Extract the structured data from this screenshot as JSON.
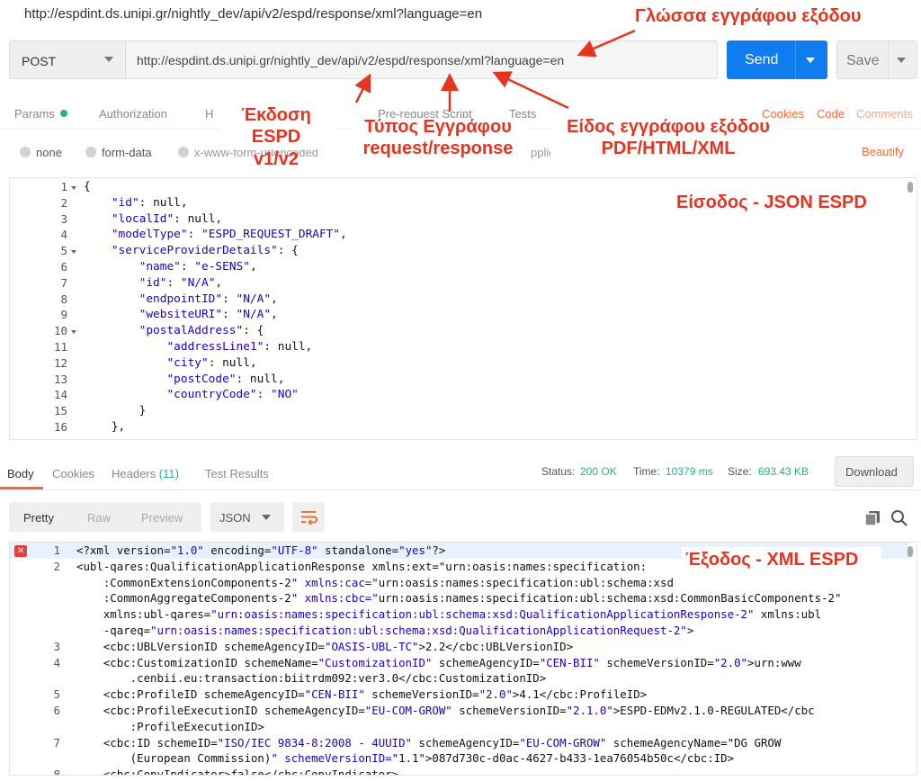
{
  "window": {
    "title_url": "http://espdint.ds.unipi.gr/nightly_dev/api/v2/espd/response/xml?language=en"
  },
  "request": {
    "method": "POST",
    "url": "http://espdint.ds.unipi.gr/nightly_dev/api/v2/espd/response/xml?language=en",
    "send_label": "Send",
    "save_label": "Save",
    "tabs": {
      "params": "Params",
      "authorization": "Authorization",
      "headers": "H",
      "prerequest": "Pre-request Script",
      "tests": "Tests",
      "cookies": "Cookies",
      "code": "Code",
      "comments": "Comments"
    },
    "body_types": {
      "none": "none",
      "form_data": "form-data",
      "x_www": "x-www-form-urlencoded",
      "application": "pplica"
    },
    "beautify": "Beautify"
  },
  "request_body": {
    "lines": [
      {
        "n": "1",
        "code": "{"
      },
      {
        "n": "2",
        "code": "    \"id\": null,"
      },
      {
        "n": "3",
        "code": "    \"localId\": null,"
      },
      {
        "n": "4",
        "code": "    \"modelType\": \"ESPD_REQUEST_DRAFT\","
      },
      {
        "n": "5",
        "code": "    \"serviceProviderDetails\": {"
      },
      {
        "n": "6",
        "code": "        \"name\": \"e-SENS\","
      },
      {
        "n": "7",
        "code": "        \"id\": \"N/A\","
      },
      {
        "n": "8",
        "code": "        \"endpointID\": \"N/A\","
      },
      {
        "n": "9",
        "code": "        \"websiteURI\": \"N/A\","
      },
      {
        "n": "10",
        "code": "        \"postalAddress\": {"
      },
      {
        "n": "11",
        "code": "            \"addressLine1\": null,"
      },
      {
        "n": "12",
        "code": "            \"city\": null,"
      },
      {
        "n": "13",
        "code": "            \"postCode\": null,"
      },
      {
        "n": "14",
        "code": "            \"countryCode\": \"NO\""
      },
      {
        "n": "15",
        "code": "        }"
      },
      {
        "n": "16",
        "code": "    },"
      }
    ]
  },
  "response": {
    "tabs": {
      "body": "Body",
      "cookies": "Cookies",
      "headers": "Headers",
      "headers_count": "(11)",
      "tests": "Test Results"
    },
    "status_label": "Status:",
    "status_value": "200 OK",
    "time_label": "Time:",
    "time_value": "10379 ms",
    "size_label": "Size:",
    "size_value": "693.43 KB",
    "download": "Download",
    "view_modes": {
      "pretty": "Pretty",
      "raw": "Raw",
      "preview": "Preview"
    },
    "format": "JSON",
    "colors": {
      "accent": "#f26b3a",
      "send": "#0f7cf0",
      "ok": "#26b47f",
      "annotation": "#e5341f"
    }
  },
  "response_body": {
    "lines": [
      {
        "n": "1",
        "code": "<?xml version=\"1.0\" encoding=\"UTF-8\" standalone=\"yes\"?>"
      },
      {
        "n": "2",
        "code": "<ubl-qares:QualificationApplicationResponse xmlns:ext=\"urn:oasis:names:specification:"
      },
      {
        "n": "",
        "code": "    :CommonExtensionComponents-2\" xmlns:cac=\"urn:oasis:names:specification:ubl:schema:xsd"
      },
      {
        "n": "",
        "code": "    :CommonAggregateComponents-2\" xmlns:cbc=\"urn:oasis:names:specification:ubl:schema:xsd:CommonBasicComponents-2\""
      },
      {
        "n": "",
        "code": "    xmlns:ubl-qares=\"urn:oasis:names:specification:ubl:schema:xsd:QualificationApplicationResponse-2\" xmlns:ubl"
      },
      {
        "n": "",
        "code": "    -qareq=\"urn:oasis:names:specification:ubl:schema:xsd:QualificationApplicationRequest-2\">"
      },
      {
        "n": "3",
        "code": "    <cbc:UBLVersionID schemeAgencyID=\"OASIS-UBL-TC\">2.2</cbc:UBLVersionID>"
      },
      {
        "n": "4",
        "code": "    <cbc:CustomizationID schemeName=\"CustomizationID\" schemeAgencyID=\"CEN-BII\" schemeVersionID=\"2.0\">urn:www"
      },
      {
        "n": "",
        "code": "        .cenbii.eu:transaction:biitrdm092:ver3.0</cbc:CustomizationID>"
      },
      {
        "n": "5",
        "code": "    <cbc:ProfileID schemeAgencyID=\"CEN-BII\" schemeVersionID=\"2.0\">4.1</cbc:ProfileID>"
      },
      {
        "n": "6",
        "code": "    <cbc:ProfileExecutionID schemeAgencyID=\"EU-COM-GROW\" schemeVersionID=\"2.1.0\">ESPD-EDMv2.1.0-REGULATED</cbc"
      },
      {
        "n": "",
        "code": "        :ProfileExecutionID>"
      },
      {
        "n": "7",
        "code": "    <cbc:ID schemeID=\"ISO/IEC 9834-8:2008 - 4UUID\" schemeAgencyID=\"EU-COM-GROW\" schemeAgencyName=\"DG GROW"
      },
      {
        "n": "",
        "code": "        (European Commission)\" schemeVersionID=\"1.1\">087d730c-d0ac-4627-b433-1ea76054b50c</cbc:ID>"
      },
      {
        "n": "8",
        "code": "    <cbc:CopyIndicator>false</cbc:CopyIndicator>"
      }
    ]
  },
  "annotations": {
    "language": "Γλώσσα εγγράφου εξόδου",
    "version_l1": "Έκδοση ESPD",
    "version_l2": "v1/v2",
    "type_l1": "Τύπος Εγγράφου",
    "type_l2": "request/response",
    "kind_l1": "Είδος εγγράφου εξόδου",
    "kind_l2": "PDF/HTML/XML",
    "input": "Είσοδος - JSON ESPD",
    "output": "Έξοδος - XML ESPD"
  }
}
